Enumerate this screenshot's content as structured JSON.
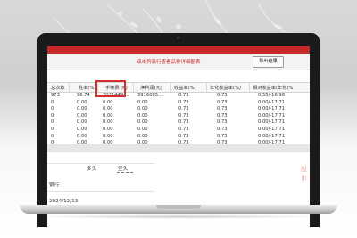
{
  "window": {
    "title": "双击列表行查看品种详细图表",
    "export_label": "导出结果"
  },
  "table": {
    "columns": [
      "总次数",
      "胜率(%)",
      "手续费(元)",
      "净利润(元)",
      "收益率(%)",
      "年化收益率(%)",
      "相对收益率(年化)%"
    ],
    "rows": [
      [
        "973",
        "96.74",
        "2021449....",
        "3916085....",
        "0.73",
        "0.73",
        "0.55/-16.98"
      ],
      [
        "0",
        "0.00",
        "0.00",
        "0.00",
        "0.73",
        "0.73",
        "0.00/-17.71"
      ],
      [
        "0",
        "0.00",
        "0.00",
        "0.00",
        "0.73",
        "0.73",
        "0.00/-17.71"
      ],
      [
        "0",
        "0.00",
        "0.00",
        "0.00",
        "0.73",
        "0.73",
        "0.00/-17.71"
      ],
      [
        "0",
        "0.00",
        "0.00",
        "0.00",
        "0.73",
        "0.73",
        "0.00/-17.71"
      ],
      [
        "0",
        "0.00",
        "0.00",
        "0.00",
        "0.73",
        "0.73",
        "0.00/-17.71"
      ],
      [
        "0",
        "0.00",
        "0.00",
        "0.00",
        "0.73",
        "0.73",
        "0.00/-17.71"
      ],
      [
        "0",
        "0.00",
        "0.00",
        "0.00",
        "0.73",
        "0.73",
        "0.00/-17.71"
      ]
    ]
  },
  "lower": {
    "tab_long": "多头",
    "tab_short": "空头",
    "label_bank": "银行",
    "date": "2024/12/13",
    "watermark": "股市"
  },
  "colors": {
    "accent": "#c62828",
    "highlight": "#d32f2f"
  }
}
